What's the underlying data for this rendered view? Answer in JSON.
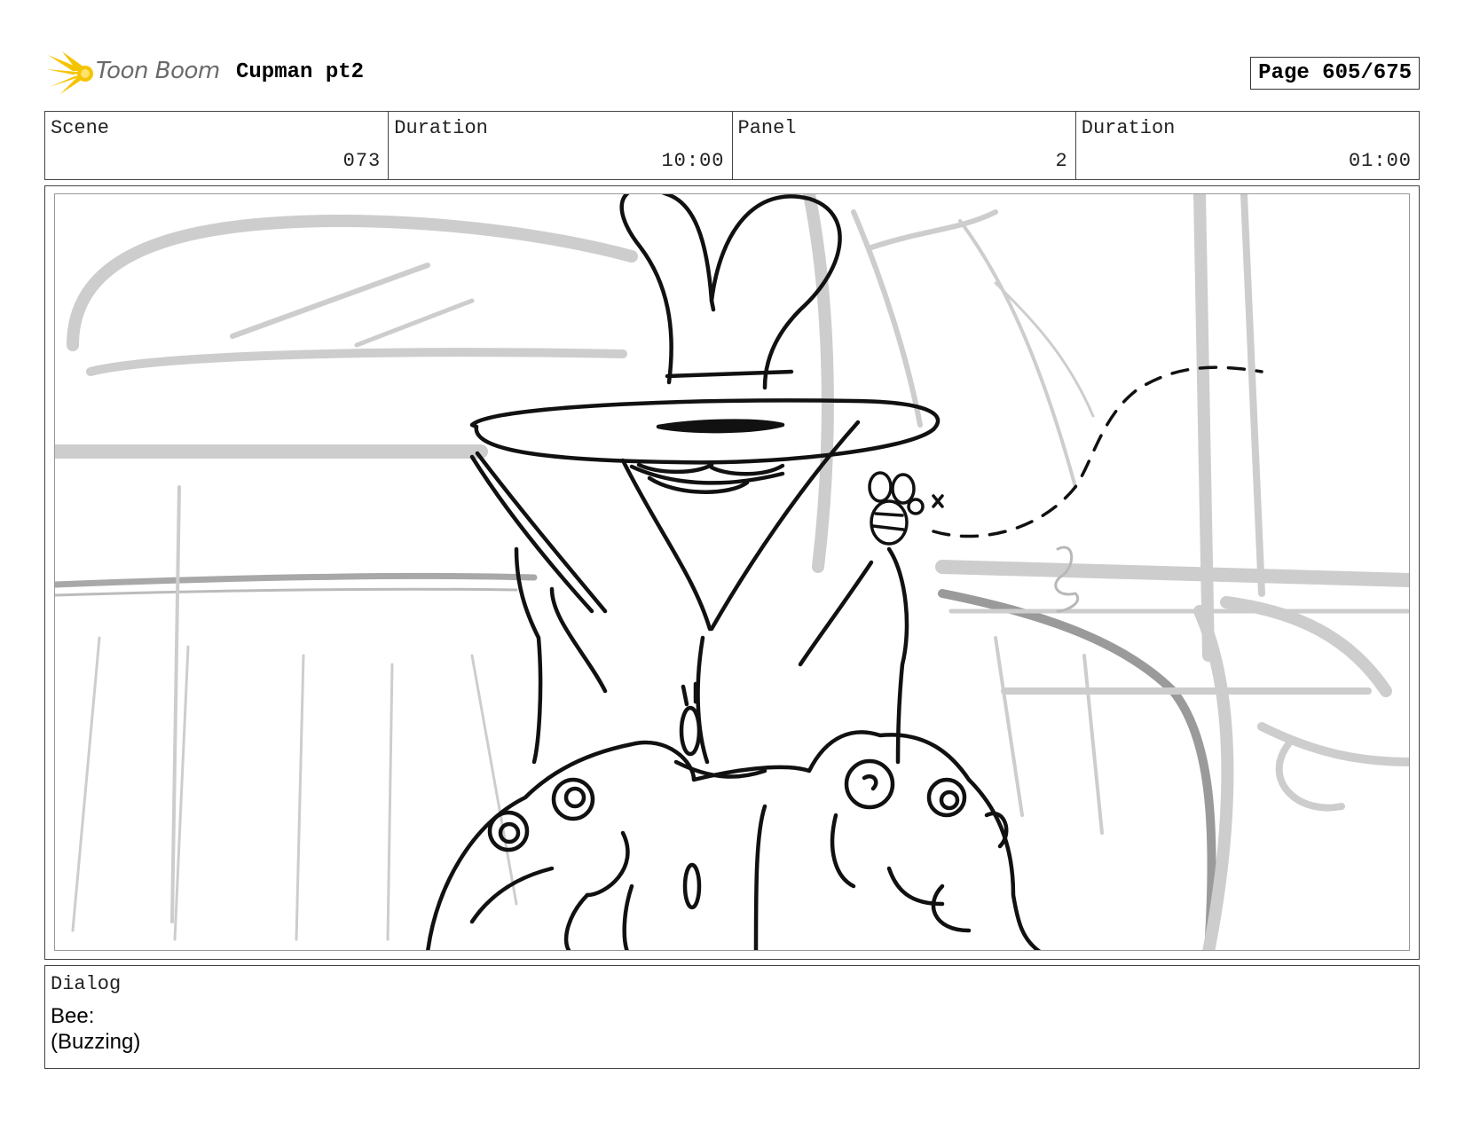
{
  "header": {
    "logo_text": "Toon Boom",
    "project_title": "Cupman pt2",
    "page_label": "Page 605/675"
  },
  "info": {
    "scene_label": "Scene",
    "scene_value": "073",
    "scene_duration_label": "Duration",
    "scene_duration_value": "10:00",
    "panel_label": "Panel",
    "panel_value": "2",
    "panel_duration_label": "Duration",
    "panel_duration_value": "01:00"
  },
  "dialog": {
    "label": "Dialog",
    "speaker": "Bee:",
    "line": "(Buzzing)"
  },
  "colors": {
    "logo_accent": "#f5c400",
    "sketch_ink": "#111111",
    "background_sketch": "#c9c9c9"
  }
}
